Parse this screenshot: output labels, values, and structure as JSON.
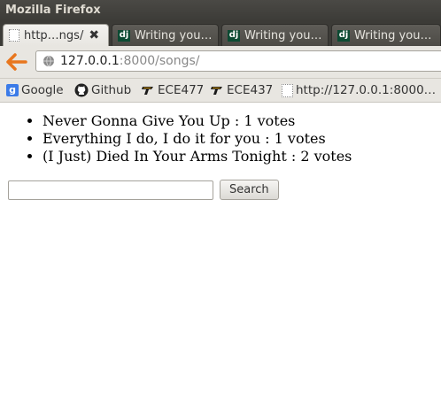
{
  "window": {
    "title": "Mozilla Firefox"
  },
  "tabs": [
    {
      "label": "http…ngs/",
      "active": true,
      "icon": "blank-page-icon"
    },
    {
      "label": "Writing you…",
      "active": false,
      "icon": "django-icon"
    },
    {
      "label": "Writing you…",
      "active": false,
      "icon": "django-icon"
    },
    {
      "label": "Writing you…",
      "active": false,
      "icon": "django-icon"
    }
  ],
  "navbar": {
    "url_host": "127.0.0.1",
    "url_rest": ":8000/songs/"
  },
  "bookmarks": [
    {
      "label": "Google",
      "icon": "google-icon"
    },
    {
      "label": "Github",
      "icon": "github-icon"
    },
    {
      "label": "ECE477",
      "icon": "bookmark-icon"
    },
    {
      "label": "ECE437",
      "icon": "bookmark-icon"
    },
    {
      "label": "http://127.0.0.1:8000…",
      "icon": "blank-page-icon"
    }
  ],
  "songs": [
    "Never Gonna Give You Up : 1 votes",
    "Everything I do, I do it for you : 1 votes",
    "(I Just) Died In Your Arms Tonight : 2 votes"
  ],
  "search": {
    "value": "",
    "button_label": "Search"
  },
  "colors": {
    "titlebar": "#3c3b37",
    "chrome": "#e8e6e1",
    "back_arrow": "#e8761e",
    "django_green": "#0c4b33"
  }
}
